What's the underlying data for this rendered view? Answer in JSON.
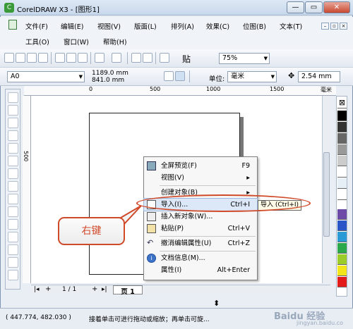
{
  "window": {
    "title": "CorelDRAW X3 - [图形1]"
  },
  "menu": {
    "row1": [
      "文件(F)",
      "编辑(E)",
      "视图(V)",
      "版面(L)",
      "排列(A)",
      "效果(C)",
      "位图(B)",
      "文本(T)"
    ],
    "row2": [
      "工具(O)",
      "窗口(W)",
      "帮助(H)"
    ]
  },
  "toolbar": {
    "zoom": "75%",
    "snap_label": "贴"
  },
  "property_bar": {
    "paper": "A0",
    "width": "1189.0 mm",
    "height": "841.0 mm",
    "units_label": "单位:",
    "units_value": "毫米",
    "nudge": "2.54 mm"
  },
  "ruler": {
    "h_ticks": [
      "0",
      "500",
      "1000",
      "1500"
    ],
    "h_unit": "毫米",
    "v_ticks": [
      "500"
    ]
  },
  "page_tabs": {
    "count": "1 / 1",
    "current": "页 1"
  },
  "context_menu": {
    "items": [
      {
        "label": "全屏预览(F)",
        "shortcut": "F9",
        "icon": "monitor-icon"
      },
      {
        "label": "视图(V)",
        "shortcut": "▸",
        "icon": ""
      },
      {
        "label": "创建对象(B)",
        "shortcut": "▸",
        "icon": ""
      },
      {
        "label": "导入(I)...",
        "shortcut": "Ctrl+I",
        "icon": "import-icon"
      },
      {
        "label": "插入新对象(W)...",
        "shortcut": "",
        "icon": "insert-object-icon"
      },
      {
        "label": "粘贴(P)",
        "shortcut": "Ctrl+V",
        "icon": "paste-icon"
      },
      {
        "label": "撤消编辑属性(U)",
        "shortcut": "Ctrl+Z",
        "icon": "undo-icon"
      },
      {
        "label": "文档信息(M)...",
        "shortcut": "",
        "icon": "info-icon"
      },
      {
        "label": "属性(I)",
        "shortcut": "Alt+Enter",
        "icon": ""
      }
    ]
  },
  "tooltip": {
    "text": "导入 (Ctrl+I)"
  },
  "callout": {
    "text": "右键"
  },
  "status": {
    "coords": "( 447.774, 482.030 )",
    "hint": "接着单击可进行拖动或缩放；再单击可旋..."
  },
  "watermark": {
    "text": "Baidu 经验",
    "url": "jingyan.baidu.co"
  },
  "colors": {
    "accent": "#d04a2a",
    "highlight": "#3399ff"
  }
}
